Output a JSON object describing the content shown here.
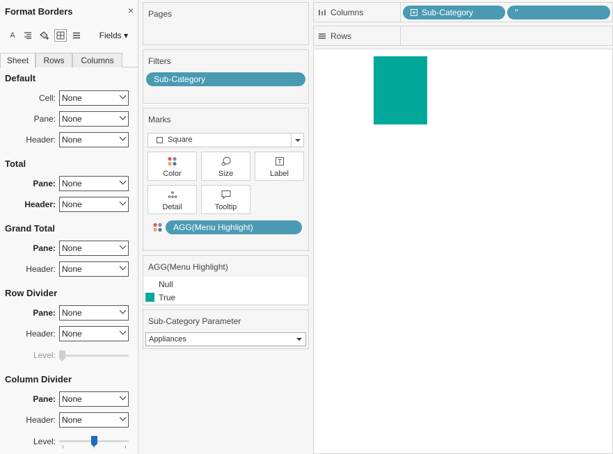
{
  "format_pane": {
    "title": "Format Borders",
    "close": "×",
    "toolbar": {
      "font_icon": "A",
      "fields_label": "Fields ▾"
    },
    "tabs": [
      "Sheet",
      "Rows",
      "Columns"
    ],
    "sections": {
      "default": {
        "title": "Default",
        "cell_label": "Cell:",
        "cell_value": "None",
        "pane_label": "Pane:",
        "pane_value": "None",
        "header_label": "Header:",
        "header_value": "None"
      },
      "total": {
        "title": "Total",
        "pane_label": "Pane:",
        "pane_value": "None",
        "header_label": "Header:",
        "header_value": "None"
      },
      "grand_total": {
        "title": "Grand Total",
        "pane_label": "Pane:",
        "pane_value": "None",
        "header_label": "Header:",
        "header_value": "None"
      },
      "row_divider": {
        "title": "Row Divider",
        "pane_label": "Pane:",
        "pane_value": "None",
        "header_label": "Header:",
        "header_value": "None",
        "level_label": "Level:",
        "level_value": 0
      },
      "column_divider": {
        "title": "Column Divider",
        "pane_label": "Pane:",
        "pane_value": "None",
        "header_label": "Header:",
        "header_value": "None",
        "level_label": "Level:",
        "level_value": 0.5
      }
    }
  },
  "cards": {
    "pages_title": "Pages",
    "filters_title": "Filters",
    "filter_pill": "Sub-Category",
    "marks_title": "Marks",
    "mark_type": "Square",
    "mark_buttons": [
      "Color",
      "Size",
      "Label",
      "Detail",
      "Tooltip"
    ],
    "color_pill": "AGG(Menu Highlight)",
    "legend": {
      "title": "AGG(Menu Highlight)",
      "items": [
        {
          "label": "Null",
          "color": ""
        },
        {
          "label": "True",
          "color": "#00a89a"
        }
      ]
    },
    "parameter": {
      "title": "Sub-Category Parameter",
      "value": "Appliances"
    }
  },
  "shelves": {
    "columns_label": "Columns",
    "columns_pills": [
      "Sub-Category",
      "''"
    ],
    "rows_label": "Rows"
  },
  "view": {
    "mark_color": "#00a89a"
  }
}
